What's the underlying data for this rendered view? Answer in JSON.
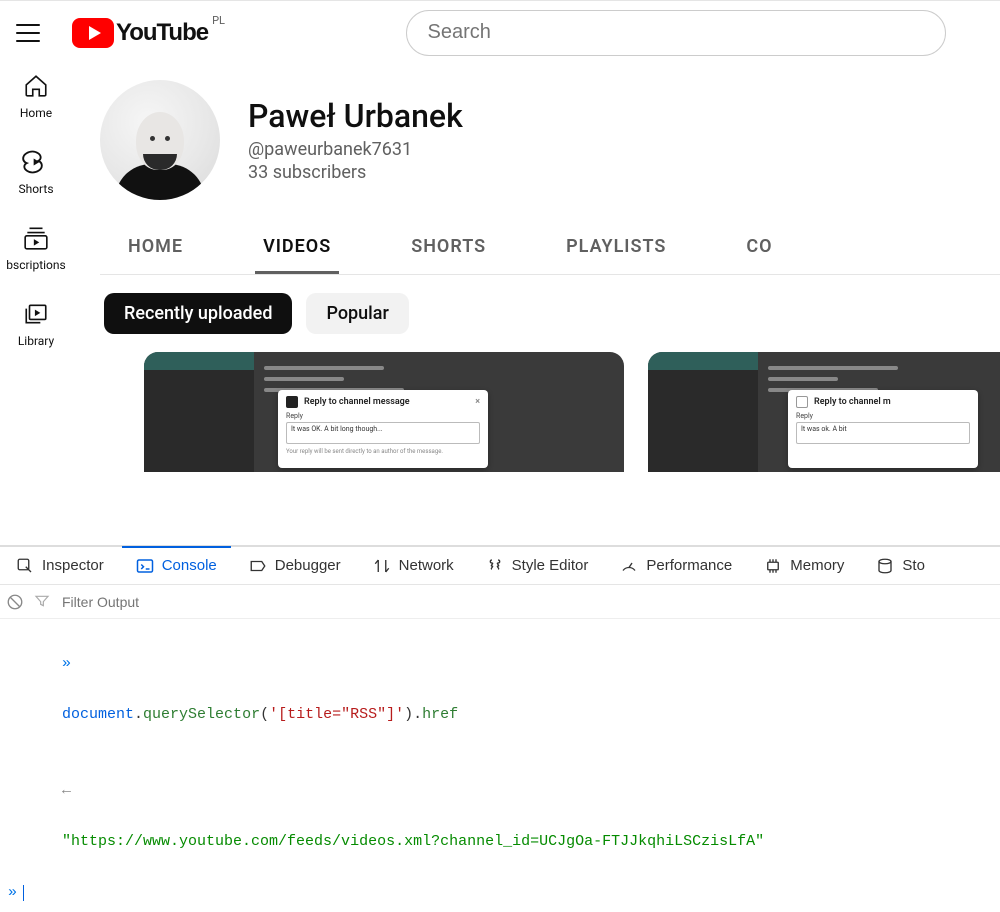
{
  "header": {
    "region": "PL",
    "logo_text": "YouTube",
    "search_placeholder": "Search"
  },
  "rail": {
    "home": "Home",
    "shorts": "Shorts",
    "subscriptions": "bscriptions",
    "library": "Library"
  },
  "channel": {
    "name": "Paweł Urbanek",
    "handle": "@paweurbanek7631",
    "subscribers": "33 subscribers"
  },
  "tabs": {
    "home": "HOME",
    "videos": "VIDEOS",
    "shorts": "SHORTS",
    "playlists": "PLAYLISTS",
    "community": "CO"
  },
  "chips": {
    "recent": "Recently uploaded",
    "popular": "Popular"
  },
  "thumb_dialog": {
    "title": "Reply to channel message",
    "label": "Reply",
    "input": "It was OK. A bit long though...",
    "input2": "It was ok. A bit",
    "title2": "Reply to channel m",
    "footer": "Your reply will be sent directly to an author of the message."
  },
  "devtools": {
    "tabs": {
      "inspector": "Inspector",
      "console": "Console",
      "debugger": "Debugger",
      "network": "Network",
      "style": "Style Editor",
      "performance": "Performance",
      "memory": "Memory",
      "storage": "Sto"
    },
    "filter_placeholder": "Filter Output",
    "console_lines": {
      "prompt": "»",
      "cmd_pre": "document",
      "cmd_dot1": ".",
      "cmd_m1": "querySelector",
      "cmd_p1": "(",
      "cmd_arg": "'[title=\"RSS\"]'",
      "cmd_p2": ").",
      "cmd_m2": "href",
      "result_arrow": "←",
      "result": "\"https://www.youtube.com/feeds/videos.xml?channel_id=UCJgOa-FTJJkqhiLSCzisLfA\""
    }
  }
}
